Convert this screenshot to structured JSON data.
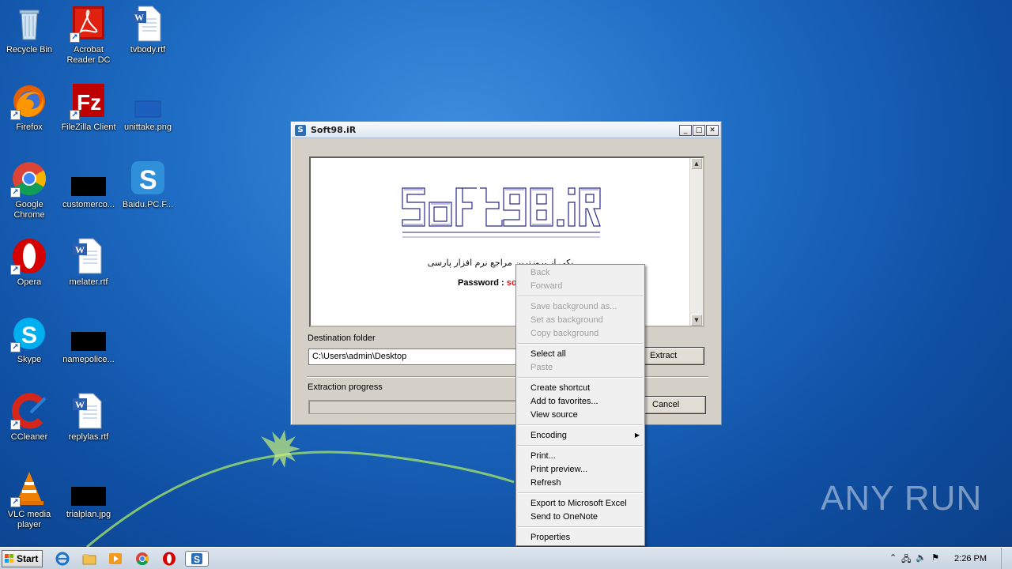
{
  "desktop": {
    "icons": [
      {
        "label": "Recycle Bin",
        "icon": "recycle-bin-icon"
      },
      {
        "label": "Acrobat Reader DC",
        "icon": "acrobat-icon"
      },
      {
        "label": "tvbody.rtf",
        "icon": "word-doc-icon"
      },
      {
        "label": "Firefox",
        "icon": "firefox-icon"
      },
      {
        "label": "FileZilla Client",
        "icon": "filezilla-icon"
      },
      {
        "label": "unittake.png",
        "icon": "image-file-icon"
      },
      {
        "label": "Google Chrome",
        "icon": "chrome-icon"
      },
      {
        "label": "customerco...",
        "icon": "black-file-icon"
      },
      {
        "label": "Baidu.PC.F...",
        "icon": "skype-like-icon"
      },
      {
        "label": "Opera",
        "icon": "opera-icon"
      },
      {
        "label": "melater.rtf",
        "icon": "word-doc-icon"
      },
      {
        "label": "Skype",
        "icon": "skype-icon"
      },
      {
        "label": "namepolice...",
        "icon": "black-file-icon"
      },
      {
        "label": "CCleaner",
        "icon": "ccleaner-icon"
      },
      {
        "label": "replylas.rtf",
        "icon": "word-doc-icon"
      },
      {
        "label": "VLC media player",
        "icon": "vlc-icon"
      },
      {
        "label": "trialplan.jpg",
        "icon": "black-file-icon"
      }
    ],
    "watermark": "ANY RUN"
  },
  "window": {
    "title": "Soft98.iR",
    "app_icon": "S",
    "tagline": "یکی از بروزترین مراجع نرم افزار پارسی",
    "password_label": "Password : ",
    "password_value": "so",
    "destination_label": "Destination folder",
    "destination_value": "C:\\Users\\admin\\Desktop",
    "extract_label": "Extract",
    "progress_label": "Extraction progress",
    "cancel_label": "Cancel",
    "progress": 0
  },
  "context_menu": {
    "items": [
      {
        "label": "Back",
        "disabled": true
      },
      {
        "label": "Forward",
        "disabled": true
      },
      {
        "label": "Save background as...",
        "disabled": true
      },
      {
        "label": "Set as background",
        "disabled": true
      },
      {
        "label": "Copy background",
        "disabled": true
      },
      {
        "label": "Select all",
        "disabled": false
      },
      {
        "label": "Paste",
        "disabled": true
      },
      {
        "label": "Create shortcut",
        "disabled": false
      },
      {
        "label": "Add to favorites...",
        "disabled": false
      },
      {
        "label": "View source",
        "disabled": false
      },
      {
        "label": "Encoding",
        "disabled": false
      },
      {
        "label": "Print...",
        "disabled": false
      },
      {
        "label": "Print preview...",
        "disabled": false
      },
      {
        "label": "Refresh",
        "disabled": false
      },
      {
        "label": "Export to Microsoft Excel",
        "disabled": false
      },
      {
        "label": "Send to OneNote",
        "disabled": false
      },
      {
        "label": "Properties",
        "disabled": false
      }
    ]
  },
  "taskbar": {
    "start_label": "Start",
    "clock": "2:26 PM"
  }
}
